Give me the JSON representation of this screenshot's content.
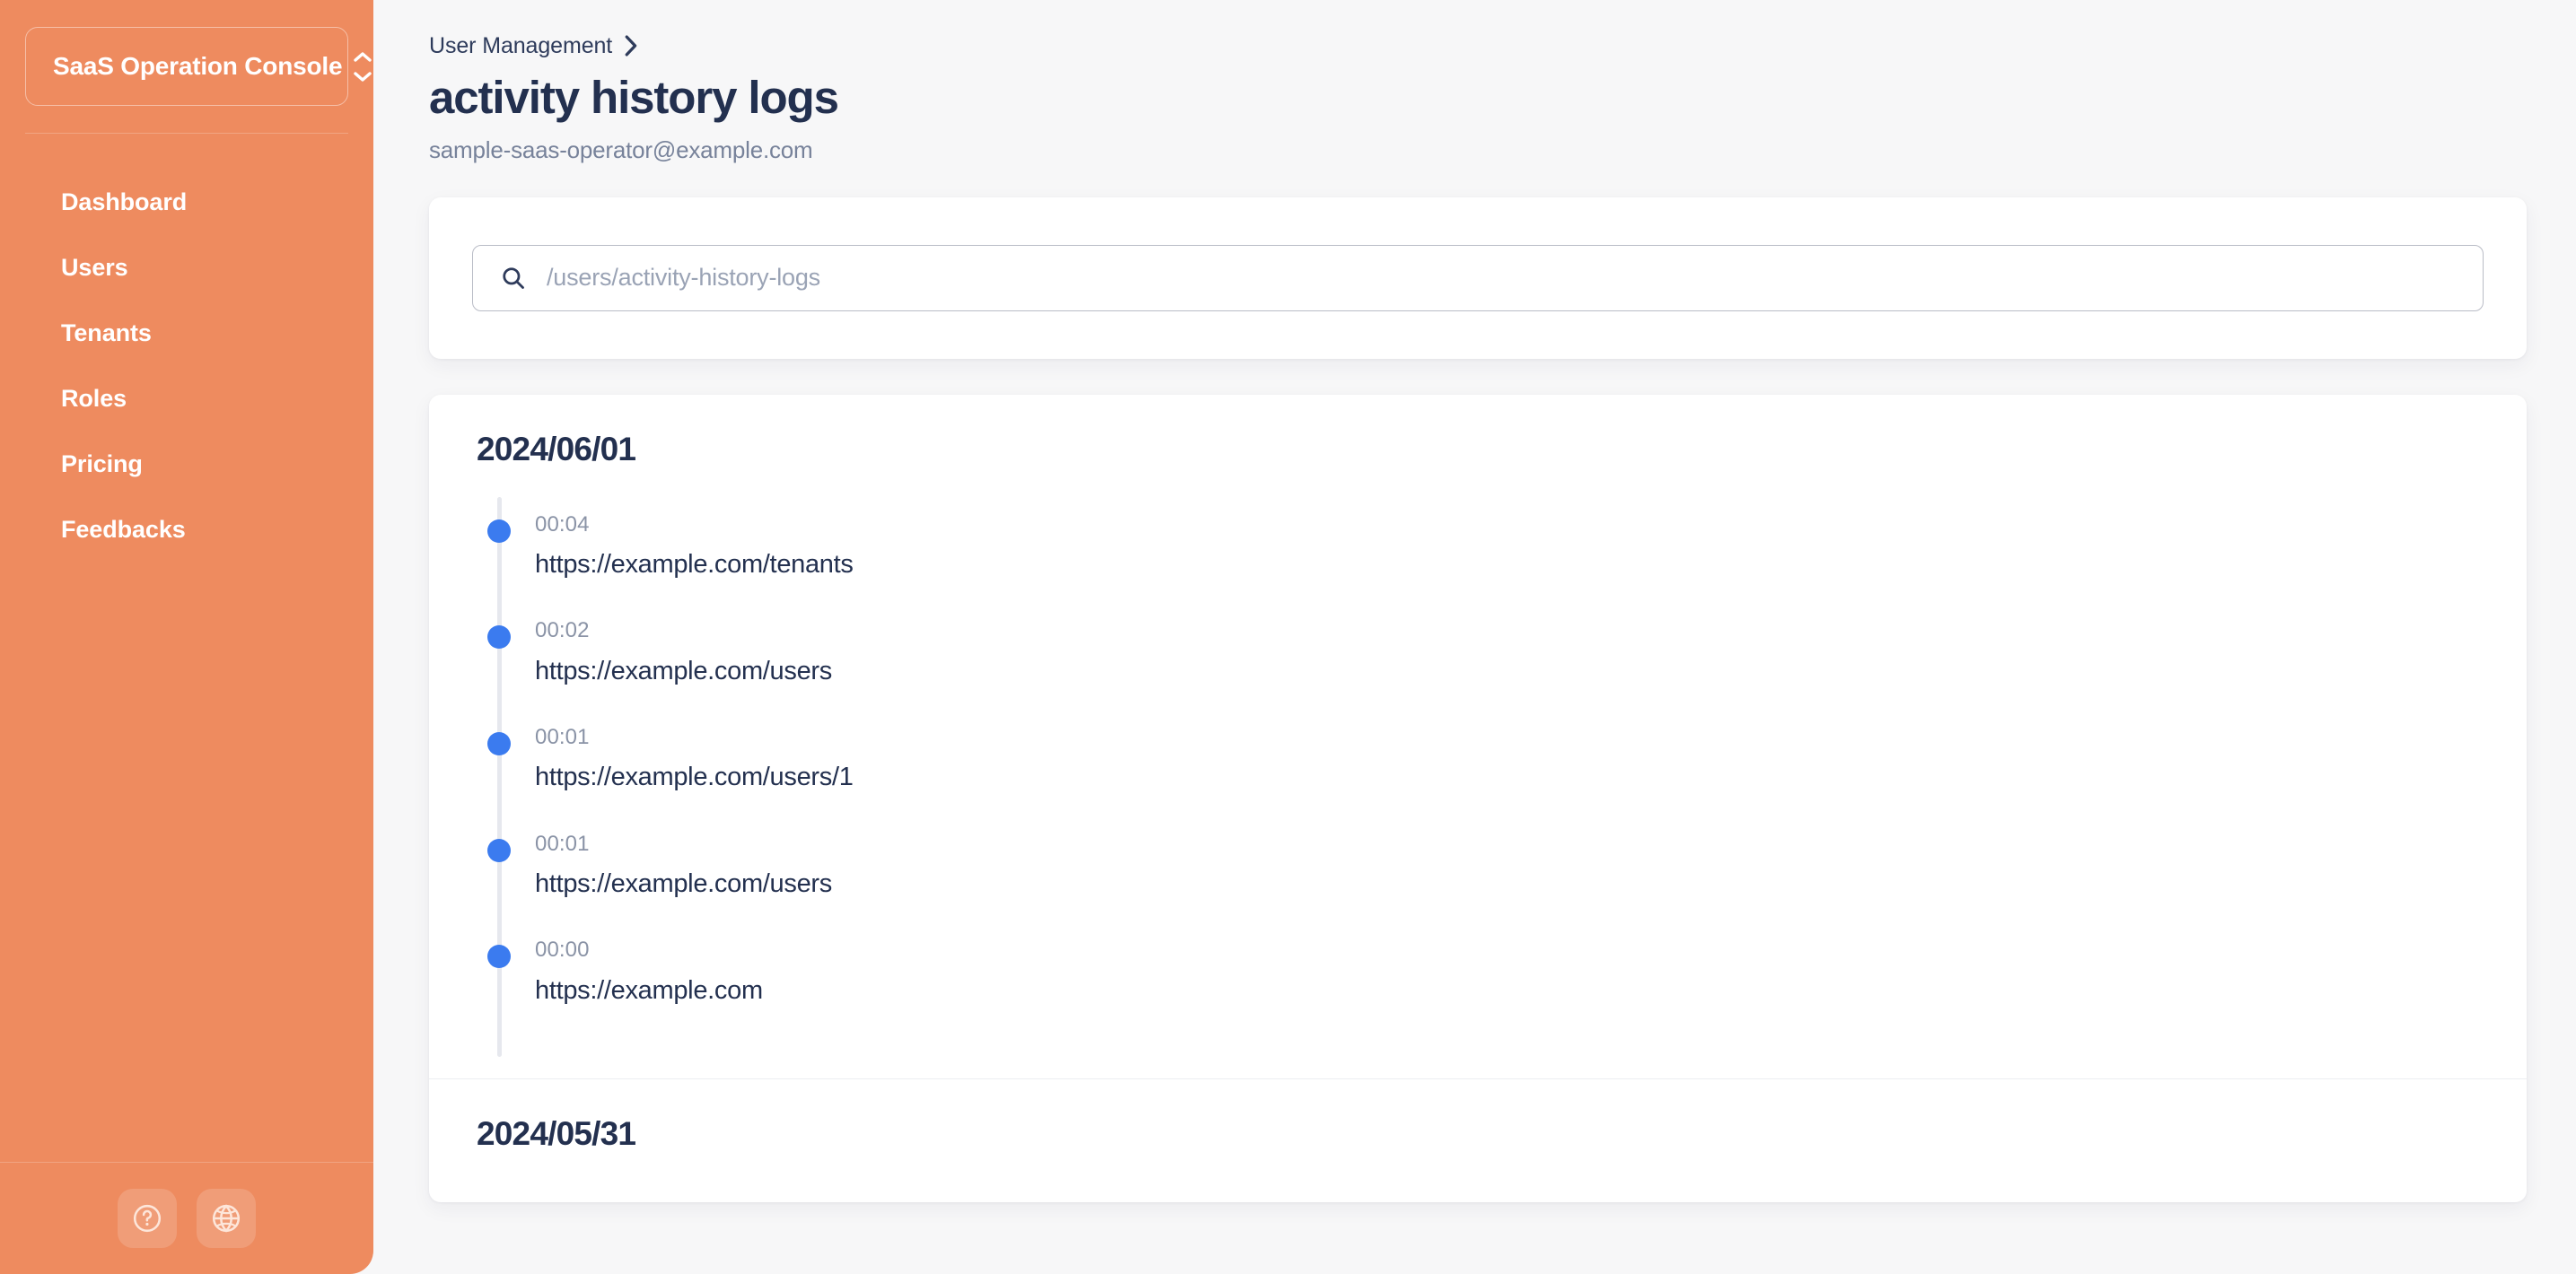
{
  "sidebar": {
    "brand": {
      "name": "SaaS Operation Console",
      "stepper_icon": "chevron-up-down-icon"
    },
    "items": [
      {
        "label": "Dashboard"
      },
      {
        "label": "Users"
      },
      {
        "label": "Tenants"
      },
      {
        "label": "Roles"
      },
      {
        "label": "Pricing"
      },
      {
        "label": "Feedbacks"
      }
    ],
    "footer": {
      "help_icon": "question-circle-icon",
      "language_icon": "globe-icon"
    }
  },
  "header": {
    "breadcrumb": {
      "parent": "User Management",
      "separator_icon": "chevron-right-icon"
    },
    "title": "activity history logs",
    "subtitle": "sample-saas-operator@example.com"
  },
  "search": {
    "icon": "search-icon",
    "value": "",
    "placeholder": "/users/activity-history-logs"
  },
  "timeline": {
    "days": [
      {
        "date": "2024/06/01",
        "entries": [
          {
            "time": "00:04",
            "url": "https://example.com/tenants"
          },
          {
            "time": "00:02",
            "url": "https://example.com/users"
          },
          {
            "time": "00:01",
            "url": "https://example.com/users/1"
          },
          {
            "time": "00:01",
            "url": "https://example.com/users"
          },
          {
            "time": "00:00",
            "url": "https://example.com"
          }
        ]
      },
      {
        "date": "2024/05/31",
        "entries": []
      }
    ]
  },
  "colors": {
    "sidebar_bg": "#ee8b5f",
    "page_bg": "#f7f7f8",
    "card_bg": "#ffffff",
    "text_dark": "#23304f",
    "text_muted": "#77829a",
    "timeline_dot": "#3b7bef",
    "timeline_rail": "#e6e8ee"
  }
}
